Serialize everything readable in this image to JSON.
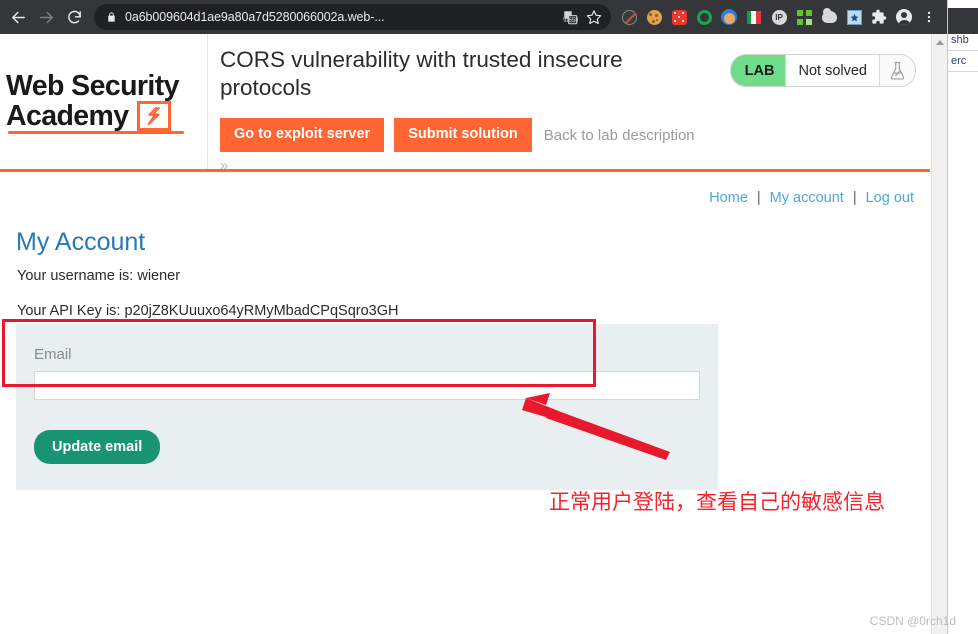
{
  "browser": {
    "url": "0a6b009604d1ae9a80a7d5280066002a.web-...",
    "back_label": "Back",
    "forward_label": "Forward",
    "reload_label": "Reload",
    "lock_icon": "lock-icon",
    "translate_icon": "translate-icon",
    "bookmark_icon": "star-icon",
    "menu_icon": "three-dots-icon",
    "extensions": [
      {
        "name": "no-cookie-icon",
        "title": ""
      },
      {
        "name": "cookie-editor-icon",
        "title": ""
      },
      {
        "name": "dice-icon",
        "title": ""
      },
      {
        "name": "green-gear-icon",
        "title": ""
      },
      {
        "name": "blue-circle-icon",
        "title": ""
      },
      {
        "name": "italy-flag-icon",
        "title": ""
      },
      {
        "name": "ip-lookup-icon",
        "title": "IP"
      },
      {
        "name": "qr-code-icon",
        "title": ""
      },
      {
        "name": "cloud-icon",
        "title": ""
      },
      {
        "name": "star-box-icon",
        "title": ""
      },
      {
        "name": "puzzle-extensions-icon",
        "title": ""
      },
      {
        "name": "profile-avatar-icon",
        "title": ""
      },
      {
        "name": "chrome-menu-icon",
        "title": ""
      }
    ]
  },
  "background_window": {
    "line1": "shb",
    "line2": "erc"
  },
  "lab": {
    "logo_line1": "Web Security",
    "logo_line2": "Academy",
    "bolt_icon": "lightning-bolt-icon",
    "title": "CORS vulnerability with trusted insecure protocols",
    "buttons": {
      "exploit_server": "Go to exploit server",
      "submit_solution": "Submit solution",
      "back_to_description": "Back to lab description",
      "expand": "»"
    },
    "status": {
      "badge": "LAB",
      "text": "Not solved",
      "flask_icon": "flask-icon",
      "badge_color": "#6fdc8c"
    }
  },
  "site": {
    "nav": [
      {
        "label": "Home"
      },
      {
        "label": "My account"
      },
      {
        "label": "Log out"
      }
    ],
    "nav_separator": "|",
    "account_heading": "My Account",
    "username_line": "Your username is: wiener",
    "apikey_line": "Your API Key is: p20jZ8KUuuxo64yRMyMbadCPqSqro3GH",
    "form": {
      "email_label": "Email",
      "email_value": "",
      "email_placeholder": "",
      "update_button": "Update email",
      "button_color": "#199473",
      "panel_color": "#e9eef0"
    }
  },
  "annotations": {
    "highlight_box_color": "#e8192c",
    "arrow_color": "#e8192c",
    "note_text": "正常用户登陆，查看自己的敏感信息",
    "watermark": "CSDN @0rch1d"
  }
}
